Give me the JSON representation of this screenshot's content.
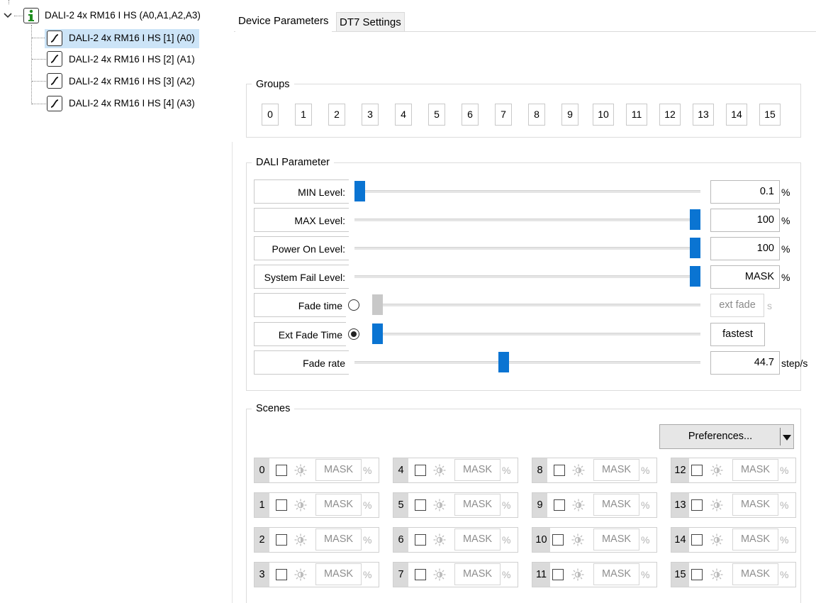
{
  "tree": {
    "root_label": "DALI-2 4x RM16 I HS (A0,A1,A2,A3)",
    "root_icon": "info-icon",
    "children": [
      {
        "label": "DALI-2 4x RM16 I HS [1] (A0)",
        "icon": "dimmer-curve-icon",
        "selected": true
      },
      {
        "label": "DALI-2 4x RM16 I HS [2] (A1)",
        "icon": "dimmer-curve-icon"
      },
      {
        "label": "DALI-2 4x RM16 I HS [3] (A2)",
        "icon": "dimmer-curve-icon"
      },
      {
        "label": "DALI-2 4x RM16 I HS [4] (A3)",
        "icon": "dimmer-curve-icon"
      }
    ]
  },
  "tabs": [
    {
      "label": "Device Parameters",
      "active": true
    },
    {
      "label": "DT7 Settings",
      "active": false
    }
  ],
  "groups": {
    "title": "Groups",
    "buttons": [
      "0",
      "1",
      "2",
      "3",
      "4",
      "5",
      "6",
      "7",
      "8",
      "9",
      "10",
      "11",
      "12",
      "13",
      "14",
      "15"
    ]
  },
  "dali": {
    "title": "DALI Parameter",
    "params": [
      {
        "label": "MIN Level:",
        "value": "0.1",
        "unit": "%",
        "slider_fraction": 0.0,
        "enabled": true
      },
      {
        "label": "MAX Level:",
        "value": "100",
        "unit": "%",
        "slider_fraction": 1.0,
        "enabled": true
      },
      {
        "label": "Power On Level:",
        "value": "100",
        "unit": "%",
        "slider_fraction": 1.0,
        "enabled": true
      },
      {
        "label": "System Fail Level:",
        "value": "MASK",
        "unit": "%",
        "slider_fraction": 1.0,
        "enabled": true
      },
      {
        "label": "Fade time",
        "value": "ext fade",
        "unit": "s",
        "slider_fraction": 0.0,
        "enabled": false,
        "radio": "unselected"
      },
      {
        "label": "Ext Fade Time",
        "value": "fastest",
        "unit": "",
        "slider_fraction": 0.0,
        "enabled": true,
        "radio": "selected"
      },
      {
        "label": "Fade rate",
        "value": "44.7",
        "unit": "step/s",
        "slider_fraction": 0.43,
        "enabled": true
      }
    ]
  },
  "scenes": {
    "title": "Scenes",
    "preferences_label": "Preferences...",
    "value": "MASK",
    "unit": "%",
    "items": [
      "0",
      "4",
      "8",
      "12",
      "1",
      "5",
      "9",
      "13",
      "2",
      "6",
      "10",
      "14",
      "3",
      "7",
      "11",
      "15"
    ],
    "light_icon": "sun-icon",
    "dropdown_icon": "triangle-down-icon"
  },
  "colors": {
    "accent": "#0a74d2",
    "selection": "#cce4f7",
    "info_green": "#1e8c1e"
  }
}
